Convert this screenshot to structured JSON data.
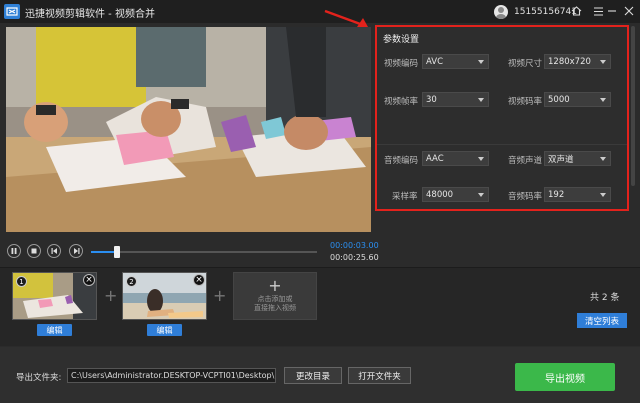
{
  "titlebar": {
    "title": "迅捷视频剪辑软件 - 视频合并",
    "user_id": "15155156741"
  },
  "settings": {
    "title": "参数设置",
    "video_codec": {
      "label": "视频编码",
      "value": "AVC"
    },
    "video_size": {
      "label": "视频尺寸",
      "value": "1280x720"
    },
    "frame_rate": {
      "label": "视频帧率",
      "value": "30"
    },
    "video_bitrate": {
      "label": "视频码率",
      "value": "5000"
    },
    "audio_codec": {
      "label": "音频编码",
      "value": "AAC"
    },
    "audio_channel": {
      "label": "音频声道",
      "value": "双声道"
    },
    "sample_rate": {
      "label": "采样率",
      "value": "48000"
    },
    "audio_bitrate": {
      "label": "音频码率",
      "value": "192"
    }
  },
  "player": {
    "current_time": "00:00:03.00",
    "total_time": "00:00:25.60",
    "progress": 0.115
  },
  "timeline": {
    "clips": [
      {
        "number": "1",
        "edit_label": "编辑"
      },
      {
        "number": "2",
        "edit_label": "编辑"
      }
    ],
    "add_hint_line1": "点击添加或",
    "add_hint_line2": "直接拖入视频",
    "count_text": "共 2 条",
    "clear_label": "清空列表"
  },
  "footer": {
    "export_folder_label": "导出文件夹:",
    "path": "C:\\Users\\Administrator.DESKTOP-VCPTI01\\Desktop\\",
    "change_dir_label": "更改目录",
    "open_folder_label": "打开文件夹",
    "export_label": "导出视频"
  },
  "colors": {
    "accent_blue": "#2f7ed8",
    "export_green": "#3bb84a",
    "highlight_red": "#e3221c"
  }
}
